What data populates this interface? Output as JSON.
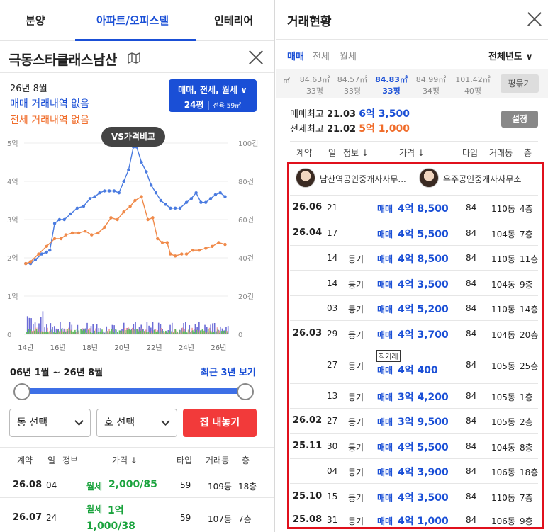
{
  "left": {
    "tabs": [
      "분양",
      "아파트/오피스텔",
      "인테리어"
    ],
    "apt_name": "극동스타클래스남산",
    "map_icon": "map-icon",
    "close_icon": "close-icon",
    "period": "26년 8월",
    "sale_none": "매매 거래내역 없음",
    "jeonse_none": "전세 거래내역 없음",
    "filter": {
      "types": "매매, 전세, 월세 ∨",
      "size": "24평",
      "size_detail": "전용 59㎡"
    },
    "vs_button": "VS가격비교",
    "range_text": "06년 1월 ~ 26년 8월",
    "recent_button": "최근 3년 보기",
    "dong_select": "동 선택",
    "ho_select": "호 선택",
    "list_button": "집 내놓기",
    "table_headers": [
      "계약",
      "일",
      "정보",
      "가격 ↓",
      "타입",
      "거래동",
      "층"
    ],
    "rows": [
      {
        "ym": "26.08",
        "day": "04",
        "kind": "월세",
        "price": "2,000/85",
        "type": "59",
        "dong": "109동",
        "floor": "18층"
      },
      {
        "ym": "26.07",
        "day": "24",
        "kind": "월세",
        "price": "1억 1,000/38",
        "type": "59",
        "dong": "107동",
        "floor": "7층"
      }
    ]
  },
  "chart_data": {
    "type": "line",
    "y_left_ticks": [
      "0",
      "1억",
      "2억",
      "3억",
      "4억",
      "5억"
    ],
    "y_right_ticks": [
      "0",
      "20건",
      "40건",
      "60건",
      "80건",
      "100건"
    ],
    "x_ticks": [
      "14년",
      "16년",
      "18년",
      "20년",
      "22년",
      "24년",
      "26년"
    ],
    "ylim": [
      0,
      5
    ],
    "xlim": [
      2013.9,
      2026.6
    ],
    "colors": {
      "sale": "#4a7be0",
      "jeonse": "#f08a4a",
      "vol_sale": "#6b6bd6",
      "vol_jeonse": "#f2a0a0",
      "vol_rent": "#5fbf5f"
    },
    "series": [
      {
        "points": [
          [
            2014.0,
            1.85
          ],
          [
            2014.3,
            1.85
          ],
          [
            2014.6,
            1.95
          ],
          [
            2015.0,
            2.1
          ],
          [
            2015.3,
            2.15
          ],
          [
            2015.5,
            2.2
          ],
          [
            2015.8,
            2.9
          ],
          [
            2016.1,
            3.0
          ],
          [
            2016.4,
            3.0
          ],
          [
            2016.8,
            3.15
          ],
          [
            2017.2,
            3.3
          ],
          [
            2017.6,
            3.35
          ],
          [
            2018.0,
            3.55
          ],
          [
            2018.3,
            3.6
          ],
          [
            2018.6,
            3.7
          ],
          [
            2018.9,
            3.75
          ],
          [
            2019.2,
            3.75
          ],
          [
            2019.5,
            3.75
          ],
          [
            2019.8,
            3.7
          ],
          [
            2020.1,
            4.0
          ],
          [
            2020.4,
            4.3
          ],
          [
            2020.7,
            4.9
          ],
          [
            2020.9,
            4.9
          ],
          [
            2021.2,
            4.5
          ],
          [
            2021.5,
            4.25
          ],
          [
            2021.8,
            3.9
          ],
          [
            2022.1,
            3.7
          ],
          [
            2022.4,
            3.5
          ],
          [
            2022.7,
            3.4
          ],
          [
            2023.0,
            3.3
          ],
          [
            2023.3,
            3.3
          ],
          [
            2023.6,
            3.3
          ],
          [
            2024.0,
            3.45
          ],
          [
            2024.3,
            3.55
          ],
          [
            2024.6,
            3.7
          ],
          [
            2024.9,
            3.45
          ],
          [
            2025.2,
            3.45
          ],
          [
            2025.5,
            3.55
          ],
          [
            2025.8,
            3.65
          ],
          [
            2026.1,
            3.7
          ],
          [
            2026.4,
            3.6
          ]
        ]
      },
      {
        "points": [
          [
            2014.0,
            1.85
          ],
          [
            2014.3,
            1.9
          ],
          [
            2014.8,
            2.1
          ],
          [
            2015.3,
            2.3
          ],
          [
            2015.8,
            2.5
          ],
          [
            2016.2,
            2.5
          ],
          [
            2016.5,
            2.6
          ],
          [
            2016.9,
            2.65
          ],
          [
            2017.3,
            2.65
          ],
          [
            2017.7,
            2.7
          ],
          [
            2018.1,
            2.6
          ],
          [
            2018.5,
            2.65
          ],
          [
            2018.9,
            2.8
          ],
          [
            2019.3,
            3.05
          ],
          [
            2019.7,
            3.0
          ],
          [
            2020.1,
            3.2
          ],
          [
            2020.5,
            3.35
          ],
          [
            2020.8,
            3.5
          ],
          [
            2021.2,
            3.6
          ],
          [
            2021.6,
            3.0
          ],
          [
            2021.9,
            3.05
          ],
          [
            2022.2,
            2.5
          ],
          [
            2022.5,
            2.4
          ],
          [
            2022.8,
            2.4
          ],
          [
            2023.0,
            2.1
          ],
          [
            2023.3,
            2.05
          ],
          [
            2023.7,
            2.1
          ],
          [
            2024.0,
            2.1
          ],
          [
            2024.4,
            2.2
          ],
          [
            2024.8,
            2.2
          ],
          [
            2025.2,
            2.25
          ],
          [
            2025.6,
            2.3
          ],
          [
            2026.0,
            2.4
          ],
          [
            2026.4,
            2.35
          ]
        ]
      }
    ]
  },
  "right": {
    "title": "거래현황",
    "close_icon": "close-icon",
    "subtabs": [
      "매매",
      "전세",
      "월세"
    ],
    "year_select": "전체년도 ∨",
    "unit": "㎡",
    "areas": [
      {
        "a": "84.63㎡",
        "p": "33평"
      },
      {
        "a": "84.57㎡",
        "p": "33평"
      },
      {
        "a": "84.83㎡",
        "p": "33평",
        "on": true
      },
      {
        "a": "84.99㎡",
        "p": "34평"
      },
      {
        "a": "101.42㎡",
        "p": "40평"
      }
    ],
    "pyeong_button": "평묶기",
    "sale_max": {
      "label": "매매최고",
      "date": "21.03",
      "price": "6억 3,500"
    },
    "jeonse_max": {
      "label": "전세최고",
      "date": "21.02",
      "price": "5억 1,000"
    },
    "set_button": "설정",
    "table_headers": [
      "계약",
      "일",
      "정보 ↓",
      "가격 ↓",
      "타입",
      "거래동",
      "층"
    ],
    "agents": [
      "남산역공인중개사사무...",
      "우주공인중개사사무소"
    ],
    "direct_tag": "직거래",
    "rows": [
      {
        "ym": "26.06",
        "day": "21",
        "info": "",
        "kind": "매매",
        "price": "4억 8,500",
        "type": "84",
        "dong": "110동",
        "floor": "4층"
      },
      {
        "ym": "26.04",
        "day": "17",
        "info": "",
        "kind": "매매",
        "price": "4억 5,500",
        "type": "84",
        "dong": "104동",
        "floor": "7층"
      },
      {
        "ym": "",
        "day": "14",
        "info": "등기",
        "kind": "매매",
        "price": "4억 8,500",
        "type": "84",
        "dong": "110동",
        "floor": "11층"
      },
      {
        "ym": "",
        "day": "14",
        "info": "등기",
        "kind": "매매",
        "price": "4억 3,500",
        "type": "84",
        "dong": "104동",
        "floor": "9층"
      },
      {
        "ym": "",
        "day": "03",
        "info": "등기",
        "kind": "매매",
        "price": "4억 5,200",
        "type": "84",
        "dong": "110동",
        "floor": "14층"
      },
      {
        "ym": "26.03",
        "day": "29",
        "info": "등기",
        "kind": "매매",
        "price": "4억 3,700",
        "type": "84",
        "dong": "104동",
        "floor": "20층"
      },
      {
        "ym": "",
        "day": "27",
        "info": "등기",
        "kind": "매매",
        "price": "4억 400",
        "type": "84",
        "dong": "105동",
        "floor": "25층",
        "direct": true
      },
      {
        "ym": "",
        "day": "13",
        "info": "등기",
        "kind": "매매",
        "price": "3억 4,200",
        "type": "84",
        "dong": "105동",
        "floor": "1층"
      },
      {
        "ym": "26.02",
        "day": "27",
        "info": "등기",
        "kind": "매매",
        "price": "3억 9,500",
        "type": "84",
        "dong": "105동",
        "floor": "2층"
      },
      {
        "ym": "25.11",
        "day": "30",
        "info": "등기",
        "kind": "매매",
        "price": "4억 5,500",
        "type": "84",
        "dong": "104동",
        "floor": "8층"
      },
      {
        "ym": "",
        "day": "04",
        "info": "등기",
        "kind": "매매",
        "price": "4억 3,900",
        "type": "84",
        "dong": "106동",
        "floor": "18층"
      },
      {
        "ym": "25.10",
        "day": "15",
        "info": "등기",
        "kind": "매매",
        "price": "4억 3,500",
        "type": "84",
        "dong": "110동",
        "floor": "7층"
      },
      {
        "ym": "25.08",
        "day": "31",
        "info": "등기",
        "kind": "매매",
        "price": "4억 1,000",
        "type": "84",
        "dong": "106동",
        "floor": "9층"
      }
    ]
  }
}
